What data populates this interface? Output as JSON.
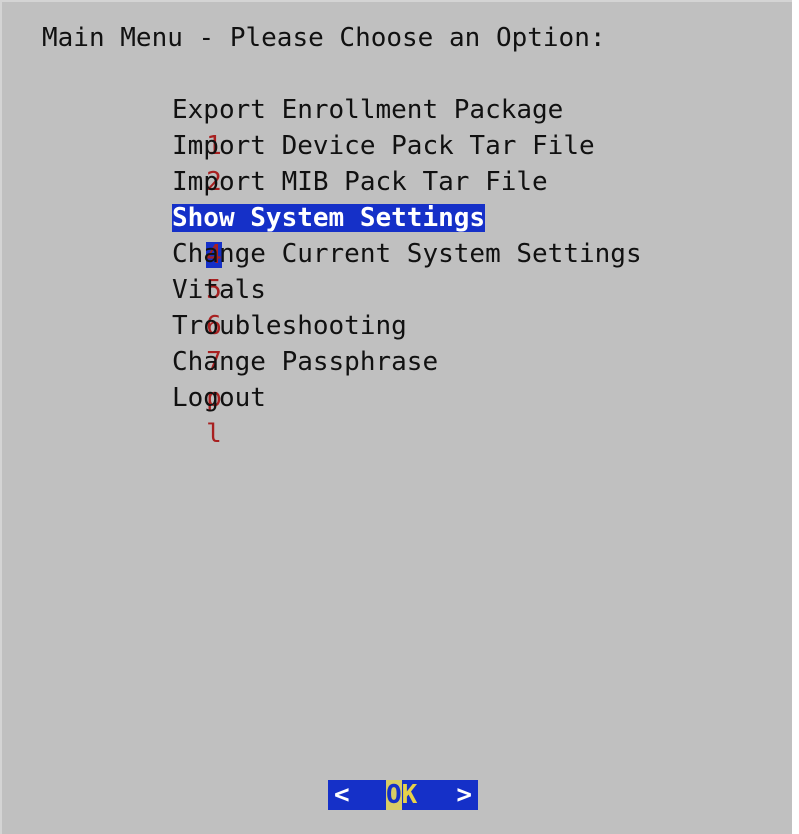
{
  "dialog": {
    "title": "Main Menu - Please Choose an Option:"
  },
  "menu": {
    "items": [
      {
        "key": "1",
        "label": "Export Enrollment Package",
        "selected": false
      },
      {
        "key": "2",
        "label": "Import Device Pack Tar File",
        "selected": false
      },
      {
        "key": "3",
        "label": "Import MIB Pack Tar File",
        "selected": false
      },
      {
        "key": "4",
        "label": "Show System Settings",
        "selected": true
      },
      {
        "key": "5",
        "label": "Change Current System Settings",
        "selected": false
      },
      {
        "key": "6",
        "label": "Vitals",
        "selected": false
      },
      {
        "key": "7",
        "label": "Troubleshooting",
        "selected": false
      },
      {
        "key": "p",
        "label": "Change Passphrase",
        "selected": false
      },
      {
        "key": "l",
        "label": "Logout",
        "selected": false
      }
    ]
  },
  "buttons": {
    "ok": {
      "left_bracket": "<",
      "cursor_char": "O",
      "rest": "K",
      "right_bracket": ">"
    }
  },
  "colors": {
    "background": "#c0c0c0",
    "highlight": "#1530c8",
    "hotkey": "#a82020",
    "button_text": "#e6d24a"
  }
}
